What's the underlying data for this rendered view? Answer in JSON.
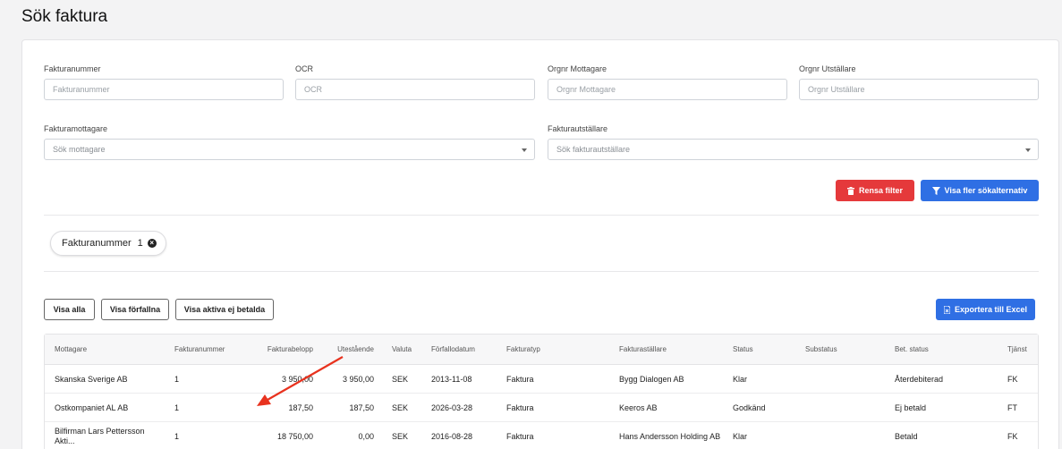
{
  "page": {
    "title": "Sök faktura"
  },
  "filters": {
    "fakturanummer": {
      "label": "Fakturanummer",
      "placeholder": "Fakturanummer"
    },
    "ocr": {
      "label": "OCR",
      "placeholder": "OCR"
    },
    "orgnr_mottagare": {
      "label": "Orgnr Mottagare",
      "placeholder": "Orgnr Mottagare"
    },
    "orgnr_utstallare": {
      "label": "Orgnr Utställare",
      "placeholder": "Orgnr Utställare"
    },
    "fakturamottagare": {
      "label": "Fakturamottagare",
      "placeholder": "Sök mottagare"
    },
    "fakturautstallare": {
      "label": "Fakturautställare",
      "placeholder": "Sök fakturautställare"
    }
  },
  "actions": {
    "clear_label": "Rensa filter",
    "more_label": "Visa fler sökalternativ"
  },
  "active_filter": {
    "label": "Fakturanummer",
    "value": "1"
  },
  "quick_filters": {
    "all": "Visa alla",
    "overdue": "Visa förfallna",
    "active_unpaid": "Visa aktiva ej betalda"
  },
  "export": {
    "label": "Exportera till Excel"
  },
  "table": {
    "headers": [
      "Mottagare",
      "Fakturanummer",
      "Fakturabelopp",
      "Utestående",
      "Valuta",
      "Förfallodatum",
      "Fakturatyp",
      "Fakturaställare",
      "Status",
      "Substatus",
      "Bet. status",
      "Tjänst"
    ],
    "rows": [
      [
        "Skanska Sverige AB",
        "1",
        "3 950,00",
        "3 950,00",
        "SEK",
        "2013-11-08",
        "Faktura",
        "Bygg Dialogen AB",
        "Klar",
        "",
        "Återdebiterad",
        "FK"
      ],
      [
        "Ostkompaniet AL AB",
        "1",
        "187,50",
        "187,50",
        "SEK",
        "2026-03-28",
        "Faktura",
        "Keeros AB",
        "Godkänd",
        "",
        "Ej betald",
        "FT"
      ],
      [
        "Bilfirman Lars Pettersson Akti...",
        "1",
        "18 750,00",
        "0,00",
        "SEK",
        "2016-08-28",
        "Faktura",
        "Hans Andersson Holding AB",
        "Klar",
        "",
        "Betald",
        "FK"
      ]
    ]
  },
  "colors": {
    "danger": "#e5393b",
    "primary": "#2f6fe4",
    "annotation_arrow": "#e8321e"
  }
}
